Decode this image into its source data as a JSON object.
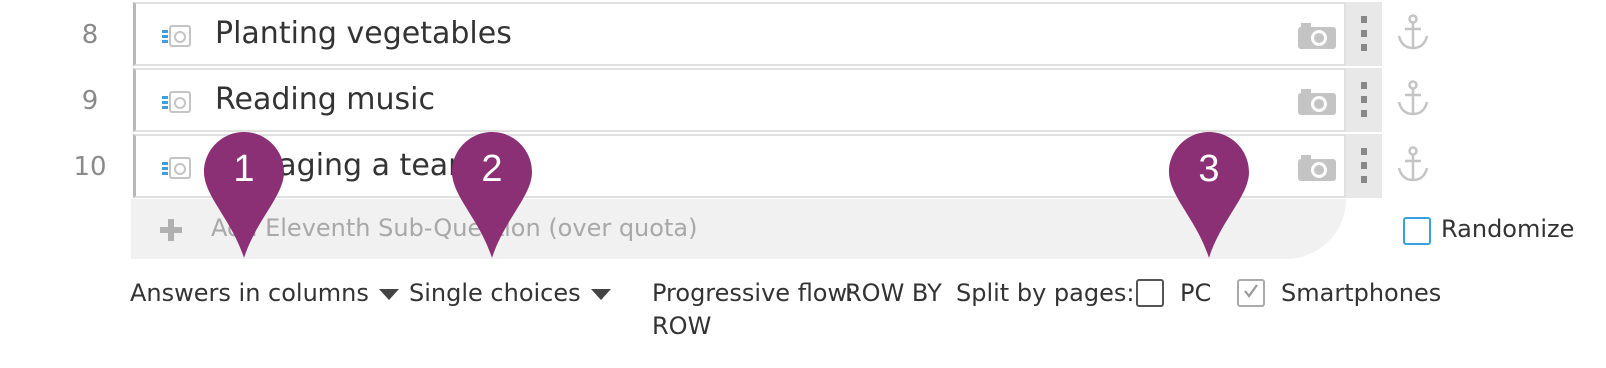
{
  "rows": [
    {
      "number": "8",
      "label": "Planting vegetables"
    },
    {
      "number": "9",
      "label": "Reading music"
    },
    {
      "number": "10",
      "label": "Managing a team"
    }
  ],
  "icons": {
    "row_type": "media-list-icon",
    "image": "camera-icon",
    "drag": "drag-handle-icon",
    "anchor": "anchor-icon",
    "add": "plus-icon"
  },
  "add_row": {
    "label": "Add Eleventh Sub-Question (over quota)"
  },
  "randomize": {
    "label": "Randomize",
    "checked": false
  },
  "controls": {
    "layout_label": "Answers in columns",
    "choice_label": "Single choices",
    "progressive_label": "Progressive flow:",
    "progressive_value_line1": "ROW BY",
    "progressive_value_line2": "ROW",
    "split_label": "Split by pages:",
    "pc_label": "PC",
    "pc_checked": false,
    "smartphones_label": "Smartphones",
    "smartphones_checked": true
  },
  "markers": [
    "1",
    "2",
    "3"
  ],
  "colors": {
    "marker": "#8c3075",
    "accent_blue": "#3aa0e0",
    "icon_grey": "#c4c4c4"
  }
}
